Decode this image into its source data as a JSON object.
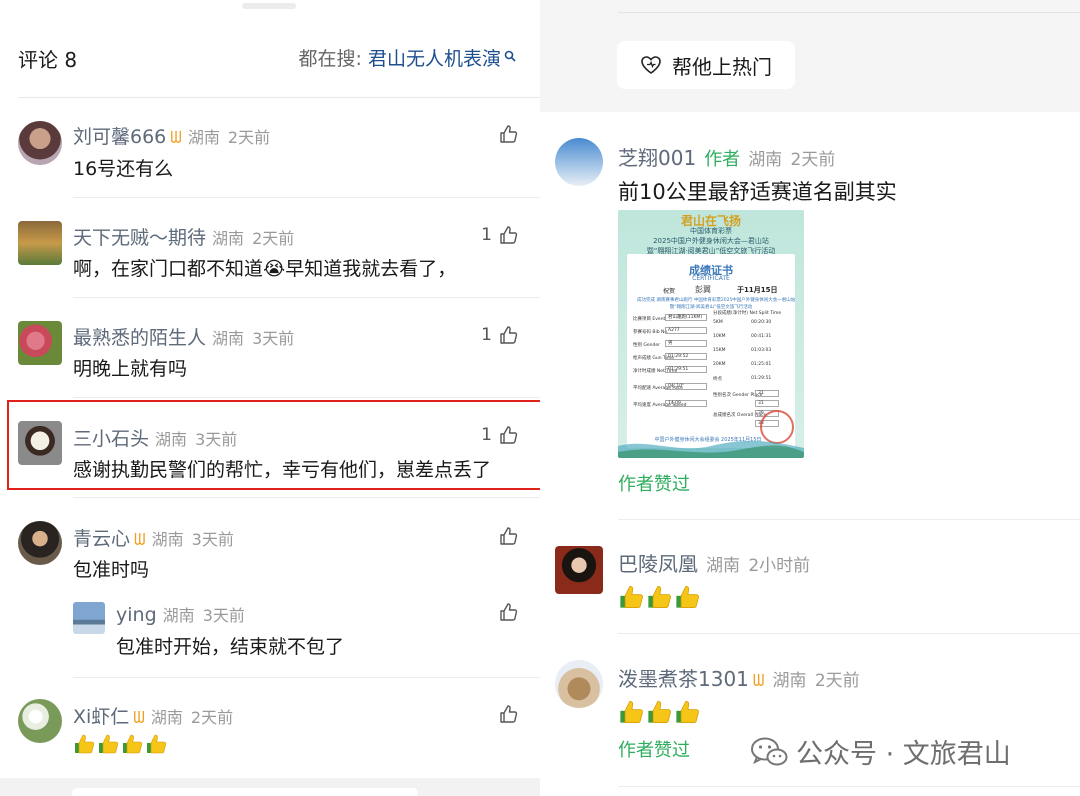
{
  "left": {
    "header": {
      "title": "评论 8",
      "trend_label": "都在搜: ",
      "trend_query": "君山无人机表演"
    },
    "comments": [
      {
        "name": "刘可馨666",
        "vip": true,
        "region": "湖南",
        "time": "2天前",
        "text": "16号还有么",
        "likes": ""
      },
      {
        "name": "天下无贼～期待",
        "vip": false,
        "region": "湖南",
        "time": "2天前",
        "text": "啊，在家门口都不知道😭早知道我就去看了，",
        "likes": "1"
      },
      {
        "name": "最熟悉的陌生人",
        "vip": false,
        "region": "湖南",
        "time": "3天前",
        "text": "明晚上就有吗",
        "likes": "1"
      },
      {
        "name": "三小石头",
        "vip": false,
        "region": "湖南",
        "time": "3天前",
        "text": "感谢执勤民警们的帮忙，幸亏有他们，崽差点丢了",
        "likes": "1"
      },
      {
        "name": "青云心",
        "vip": true,
        "region": "湖南",
        "time": "3天前",
        "text": "包准时吗",
        "likes": ""
      },
      {
        "name": "Xi虾仁",
        "vip": true,
        "region": "湖南",
        "time": "2天前",
        "text": "",
        "likes": ""
      }
    ],
    "reply": {
      "name": "ying",
      "region": "湖南",
      "time": "3天前",
      "text": "包准时开始，结束就不包了"
    }
  },
  "right": {
    "hot_button_label": "帮他上热门",
    "comments": [
      {
        "name": "芝翔001",
        "author_tag": "作者",
        "region": "湖南",
        "time": "2天前",
        "text": "前10公里最舒适赛道名副其实",
        "author_liked": "作者赞过"
      },
      {
        "name": "巴陵凤凰",
        "region": "湖南",
        "time": "2小时前"
      },
      {
        "name": "泼墨煮茶1301",
        "vip": true,
        "region": "湖南",
        "time": "2天前",
        "author_liked": "作者赞过"
      }
    ],
    "certificate": {
      "banner": "君山在飞扬",
      "org": "中国体育彩票",
      "event_line": "2025中国户外健身休闲大会—君山站",
      "event_line2": "暨“翱翔江湖·阅美君山”低空文旅飞行活动",
      "title": "成绩证书",
      "subtitle": "CERTIFICATE",
      "congrats": "祝贺",
      "name": "彭翼",
      "date": "于11月15日",
      "completed_line": "成功完成 湖南赛事君山跑行 中国体育彩票2025中国户外健身休闲大会一君山站",
      "completed_line2": "暨“翱翔江湖·阅美君山”低空文旅飞行活动",
      "rows": [
        [
          "比赛项目 Event",
          "君山趣跑(11KM)"
        ],
        [
          "参赛号码 Bib No.",
          "A277"
        ],
        [
          "性别 Gender",
          "男"
        ],
        [
          "枪声成绩 Gun Time",
          "01:29:52"
        ],
        [
          "净计时成绩 Net Time",
          "01:29:51"
        ],
        [
          "平均配速 Average Pace",
          "04' 10\""
        ],
        [
          "平均速度 Average Speed",
          "14.09"
        ]
      ],
      "splits_title": "分段成绩(净计时) Net Split Time",
      "splits": [
        [
          "5KM",
          "00:20:30"
        ],
        [
          "10KM",
          "00:41:31"
        ],
        [
          "15KM",
          "01:03:03"
        ],
        [
          "20KM",
          "01:25:01"
        ],
        [
          "终点",
          "01:29:51"
        ]
      ],
      "places": [
        [
          "性别名次 Gender Place",
          "31"
        ],
        [
          "",
          "31"
        ],
        [
          "总成绩名次 Overall Place",
          "39"
        ],
        [
          "",
          "38"
        ]
      ],
      "footer": "中国户外健身休闲大会组委会 2025年11月15日"
    },
    "watermark": "公众号 · 文旅君山"
  },
  "colors": {
    "author_green": "#2eae5e",
    "highlight_red": "#e0221b",
    "trend_blue": "#1e4f8f",
    "vip_gold": "#f0a020"
  }
}
